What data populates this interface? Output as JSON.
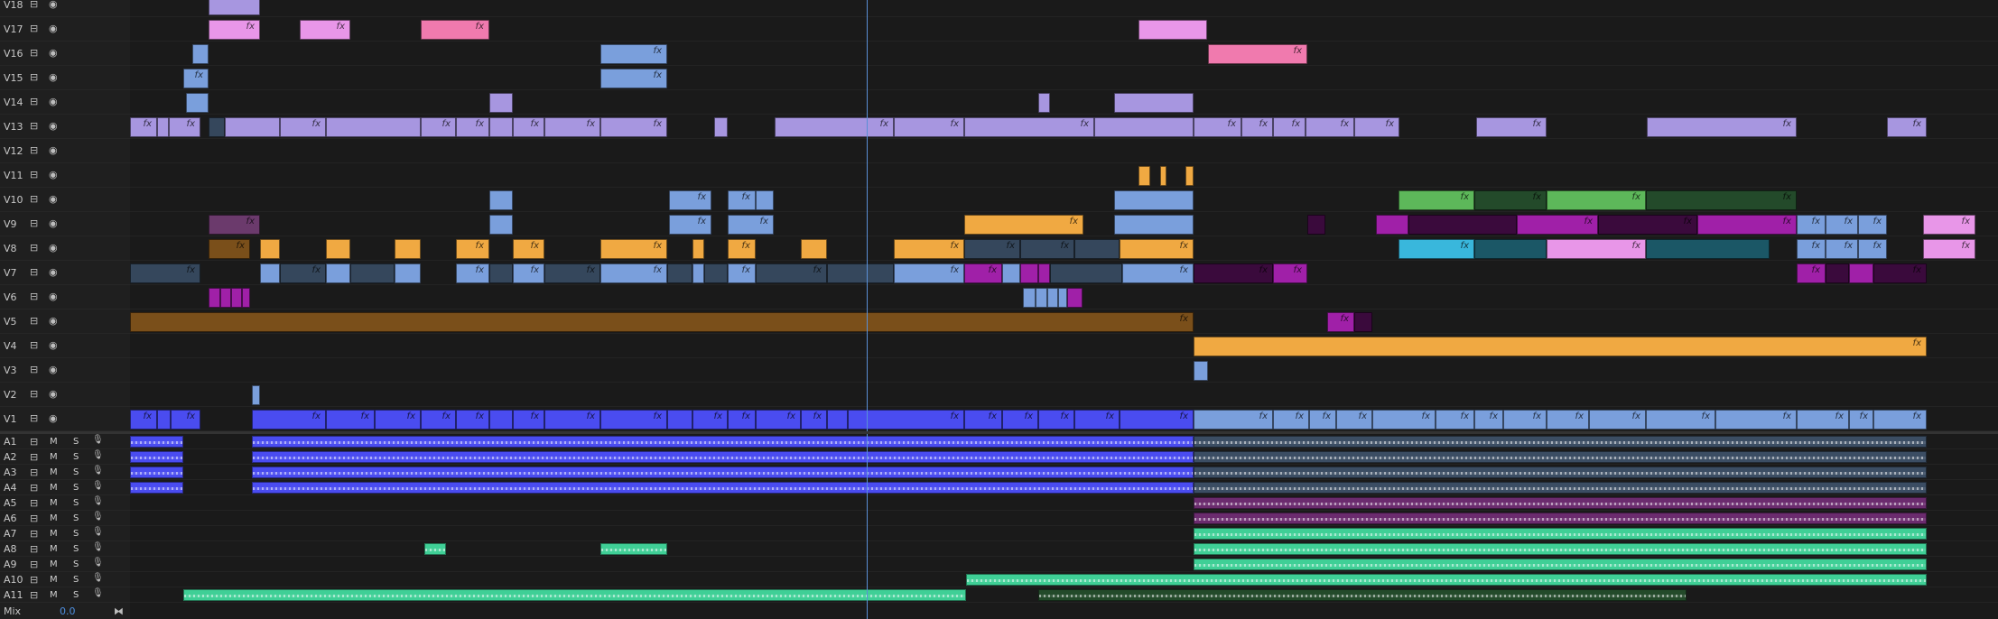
{
  "colors": {
    "lavender": "#a796e0",
    "blue": "#7a9fdc",
    "royal": "#4a4cf0",
    "orange": "#f0a942",
    "brown": "#7a4f1a",
    "pink": "#f07aae",
    "lightpink": "#e896e8",
    "magenta": "#a020a8",
    "darkmagenta": "#3a0a3c",
    "green": "#5db85a",
    "darkgreen": "#234a2a",
    "cyan": "#39b7dc",
    "teal": "#1b5766",
    "slate": "#35475c",
    "plum": "#6b3a6c",
    "mint": "#3fcf96",
    "audioslate": "#3b4d63",
    "audiopurple": "#6b2b6e",
    "audioroyal": "#4a4cf0"
  },
  "fx_label": "fx",
  "video_tracks": [
    {
      "label": "V18",
      "clips": [
        [
          231,
          288,
          "lavender",
          0
        ]
      ]
    },
    {
      "label": "V17",
      "clips": [
        [
          231,
          288,
          "lightpink",
          1
        ],
        [
          332,
          388,
          "lightpink",
          1
        ],
        [
          466,
          542,
          "pink",
          1
        ],
        [
          1261,
          1337,
          "lightpink",
          0
        ]
      ]
    },
    {
      "label": "V16",
      "clips": [
        [
          213,
          231,
          "blue",
          0
        ],
        [
          665,
          739,
          "blue",
          1
        ],
        [
          1338,
          1448,
          "pink",
          1
        ]
      ]
    },
    {
      "label": "V15",
      "clips": [
        [
          203,
          231,
          "blue",
          1
        ],
        [
          665,
          739,
          "blue",
          1
        ]
      ]
    },
    {
      "label": "V14",
      "clips": [
        [
          206,
          231,
          "blue",
          0
        ],
        [
          542,
          568,
          "lavender",
          0
        ],
        [
          1150,
          1163,
          "lavender",
          0
        ],
        [
          1234,
          1322,
          "lavender",
          0
        ]
      ]
    },
    {
      "label": "V13",
      "clips": [
        [
          144,
          174,
          "lavender",
          1
        ],
        [
          174,
          187,
          "lavender",
          0
        ],
        [
          187,
          222,
          "lavender",
          1
        ],
        [
          231,
          249,
          "slate",
          0
        ],
        [
          249,
          310,
          "lavender",
          0
        ],
        [
          310,
          361,
          "lavender",
          1
        ],
        [
          361,
          466,
          "lavender",
          0
        ],
        [
          466,
          505,
          "lavender",
          1
        ],
        [
          505,
          542,
          "lavender",
          1
        ],
        [
          542,
          568,
          "lavender",
          0
        ],
        [
          568,
          603,
          "lavender",
          1
        ],
        [
          603,
          665,
          "lavender",
          1
        ],
        [
          665,
          739,
          "lavender",
          1
        ],
        [
          791,
          806,
          "lavender",
          0
        ],
        [
          858,
          990,
          "lavender",
          1
        ],
        [
          990,
          1068,
          "lavender",
          1
        ],
        [
          1068,
          1212,
          "lavender",
          1
        ],
        [
          1212,
          1322,
          "lavender",
          0
        ],
        [
          1322,
          1375,
          "lavender",
          1
        ],
        [
          1375,
          1410,
          "lavender",
          1
        ],
        [
          1410,
          1446,
          "lavender",
          1
        ],
        [
          1446,
          1500,
          "lavender",
          1
        ],
        [
          1500,
          1550,
          "lavender",
          1
        ],
        [
          1635,
          1713,
          "lavender",
          1
        ],
        [
          1824,
          1990,
          "lavender",
          1
        ],
        [
          2090,
          2134,
          "lavender",
          1
        ]
      ]
    },
    {
      "label": "V12",
      "clips": []
    },
    {
      "label": "V11",
      "clips": [
        [
          1261,
          1274,
          "orange",
          0
        ],
        [
          1285,
          1292,
          "orange",
          0
        ],
        [
          1313,
          1322,
          "orange",
          0
        ]
      ]
    },
    {
      "label": "V10",
      "clips": [
        [
          542,
          568,
          "blue",
          0
        ],
        [
          741,
          788,
          "blue",
          1
        ],
        [
          806,
          837,
          "blue",
          1
        ],
        [
          837,
          857,
          "blue",
          0
        ],
        [
          1234,
          1322,
          "blue",
          0
        ],
        [
          1549,
          1633,
          "green",
          1
        ],
        [
          1633,
          1713,
          "darkgreen",
          1
        ],
        [
          1713,
          1823,
          "green",
          1
        ],
        [
          1823,
          1990,
          "darkgreen",
          1
        ]
      ]
    },
    {
      "label": "V9",
      "clips": [
        [
          231,
          288,
          "plum",
          1
        ],
        [
          542,
          568,
          "blue",
          0
        ],
        [
          741,
          788,
          "blue",
          1
        ],
        [
          806,
          857,
          "blue",
          1
        ],
        [
          1068,
          1200,
          "orange",
          1
        ],
        [
          1234,
          1322,
          "blue",
          0
        ],
        [
          1448,
          1468,
          "darkmagenta",
          0
        ],
        [
          1524,
          1560,
          "magenta",
          0
        ],
        [
          1560,
          1680,
          "darkmagenta",
          0
        ],
        [
          1680,
          1770,
          "magenta",
          1
        ],
        [
          1770,
          1880,
          "darkmagenta",
          1
        ],
        [
          1880,
          1990,
          "magenta",
          1
        ],
        [
          1990,
          2022,
          "blue",
          1
        ],
        [
          2022,
          2058,
          "blue",
          1
        ],
        [
          2058,
          2090,
          "blue",
          1
        ],
        [
          2130,
          2188,
          "lightpink",
          1
        ]
      ]
    },
    {
      "label": "V8",
      "clips": [
        [
          231,
          277,
          "brown",
          1
        ],
        [
          288,
          310,
          "orange",
          0
        ],
        [
          361,
          388,
          "orange",
          0
        ],
        [
          437,
          466,
          "orange",
          0
        ],
        [
          505,
          542,
          "orange",
          1
        ],
        [
          568,
          603,
          "orange",
          1
        ],
        [
          665,
          739,
          "orange",
          1
        ],
        [
          767,
          780,
          "orange",
          0
        ],
        [
          806,
          837,
          "orange",
          1
        ],
        [
          887,
          916,
          "orange",
          0
        ],
        [
          990,
          1068,
          "orange",
          1
        ],
        [
          1068,
          1130,
          "slate",
          1
        ],
        [
          1130,
          1190,
          "slate",
          1
        ],
        [
          1190,
          1240,
          "slate",
          0
        ],
        [
          1240,
          1322,
          "orange",
          1
        ],
        [
          1549,
          1633,
          "cyan",
          1
        ],
        [
          1633,
          1713,
          "teal",
          0
        ],
        [
          1713,
          1823,
          "lightpink",
          1
        ],
        [
          1823,
          1960,
          "teal",
          0
        ],
        [
          1990,
          2022,
          "blue",
          1
        ],
        [
          2022,
          2058,
          "blue",
          1
        ],
        [
          2058,
          2090,
          "blue",
          1
        ],
        [
          2130,
          2188,
          "lightpink",
          1
        ]
      ]
    },
    {
      "label": "V7",
      "clips": [
        [
          144,
          222,
          "slate",
          1
        ],
        [
          288,
          310,
          "blue",
          0
        ],
        [
          310,
          361,
          "slate",
          1
        ],
        [
          361,
          388,
          "blue",
          0
        ],
        [
          388,
          437,
          "slate",
          0
        ],
        [
          437,
          466,
          "blue",
          0
        ],
        [
          505,
          542,
          "blue",
          1
        ],
        [
          542,
          568,
          "slate",
          0
        ],
        [
          568,
          603,
          "blue",
          1
        ],
        [
          603,
          665,
          "slate",
          1
        ],
        [
          665,
          739,
          "blue",
          1
        ],
        [
          739,
          767,
          "slate",
          0
        ],
        [
          767,
          780,
          "blue",
          0
        ],
        [
          780,
          806,
          "slate",
          0
        ],
        [
          806,
          837,
          "blue",
          1
        ],
        [
          837,
          916,
          "slate",
          1
        ],
        [
          916,
          990,
          "slate",
          0
        ],
        [
          990,
          1068,
          "blue",
          1
        ],
        [
          1068,
          1110,
          "magenta",
          1
        ],
        [
          1110,
          1130,
          "blue",
          0
        ],
        [
          1130,
          1150,
          "magenta",
          0
        ],
        [
          1150,
          1163,
          "magenta",
          0
        ],
        [
          1163,
          1243,
          "slate",
          0
        ],
        [
          1243,
          1322,
          "blue",
          1
        ],
        [
          1322,
          1410,
          "darkmagenta",
          1
        ],
        [
          1410,
          1448,
          "magenta",
          1
        ],
        [
          1990,
          2022,
          "magenta",
          1
        ],
        [
          2022,
          2048,
          "darkmagenta",
          0
        ],
        [
          2048,
          2075,
          "magenta",
          0
        ],
        [
          2075,
          2134,
          "darkmagenta",
          1
        ]
      ]
    },
    {
      "label": "V6",
      "clips": [
        [
          231,
          244,
          "magenta",
          0
        ],
        [
          244,
          256,
          "magenta",
          0
        ],
        [
          256,
          268,
          "magenta",
          0
        ],
        [
          268,
          277,
          "magenta",
          0
        ],
        [
          1133,
          1147,
          "blue",
          0
        ],
        [
          1147,
          1160,
          "blue",
          0
        ],
        [
          1160,
          1172,
          "blue",
          0
        ],
        [
          1172,
          1182,
          "blue",
          0
        ],
        [
          1182,
          1199,
          "magenta",
          0
        ]
      ]
    },
    {
      "label": "V5",
      "clips": [
        [
          144,
          1322,
          "brown",
          1
        ],
        [
          1470,
          1500,
          "magenta",
          1
        ],
        [
          1500,
          1520,
          "darkmagenta",
          0
        ]
      ]
    },
    {
      "label": "V4",
      "clips": [
        [
          1322,
          2134,
          "orange",
          1
        ]
      ]
    },
    {
      "label": "V3",
      "clips": [
        [
          1322,
          1338,
          "blue",
          0
        ]
      ]
    },
    {
      "label": "V2",
      "clips": [
        [
          279,
          288,
          "blue",
          0
        ]
      ]
    },
    {
      "label": "V1",
      "clips": [
        [
          144,
          174,
          "royal",
          1
        ],
        [
          174,
          189,
          "royal",
          0
        ],
        [
          189,
          222,
          "royal",
          1
        ],
        [
          279,
          361,
          "royal",
          1
        ],
        [
          361,
          415,
          "royal",
          1
        ],
        [
          415,
          466,
          "royal",
          1
        ],
        [
          466,
          505,
          "royal",
          1
        ],
        [
          505,
          542,
          "royal",
          1
        ],
        [
          542,
          568,
          "royal",
          0
        ],
        [
          568,
          603,
          "royal",
          1
        ],
        [
          603,
          665,
          "royal",
          1
        ],
        [
          665,
          739,
          "royal",
          1
        ],
        [
          739,
          767,
          "royal",
          0
        ],
        [
          767,
          806,
          "royal",
          1
        ],
        [
          806,
          837,
          "royal",
          1
        ],
        [
          837,
          887,
          "royal",
          1
        ],
        [
          887,
          916,
          "royal",
          1
        ],
        [
          916,
          939,
          "royal",
          0
        ],
        [
          939,
          1068,
          "royal",
          1
        ],
        [
          1068,
          1110,
          "royal",
          1
        ],
        [
          1110,
          1150,
          "royal",
          1
        ],
        [
          1150,
          1190,
          "royal",
          1
        ],
        [
          1190,
          1240,
          "royal",
          1
        ],
        [
          1240,
          1322,
          "royal",
          1
        ],
        [
          1322,
          1410,
          "blue",
          1
        ],
        [
          1410,
          1450,
          "blue",
          1
        ],
        [
          1450,
          1480,
          "blue",
          1
        ],
        [
          1480,
          1520,
          "blue",
          1
        ],
        [
          1520,
          1590,
          "blue",
          1
        ],
        [
          1590,
          1633,
          "blue",
          1
        ],
        [
          1633,
          1665,
          "blue",
          1
        ],
        [
          1665,
          1713,
          "blue",
          1
        ],
        [
          1713,
          1760,
          "blue",
          1
        ],
        [
          1760,
          1823,
          "blue",
          1
        ],
        [
          1823,
          1900,
          "blue",
          1
        ],
        [
          1900,
          1990,
          "blue",
          1
        ],
        [
          1990,
          2048,
          "blue",
          1
        ],
        [
          2048,
          2075,
          "blue",
          1
        ],
        [
          2075,
          2134,
          "blue",
          1
        ]
      ]
    }
  ],
  "audio_tracks": [
    {
      "label": "A1",
      "m": "M",
      "s": "S",
      "clips": [
        [
          144,
          203,
          "audioroyal"
        ],
        [
          279,
          1322,
          "audioroyal"
        ],
        [
          1322,
          2134,
          "audioslate"
        ]
      ]
    },
    {
      "label": "A2",
      "m": "M",
      "s": "S",
      "clips": [
        [
          144,
          203,
          "audioroyal"
        ],
        [
          279,
          1322,
          "audioroyal"
        ],
        [
          1322,
          2134,
          "audioslate"
        ]
      ]
    },
    {
      "label": "A3",
      "m": "M",
      "s": "S",
      "clips": [
        [
          144,
          203,
          "audioroyal"
        ],
        [
          279,
          1322,
          "audioroyal"
        ],
        [
          1322,
          2134,
          "audioslate"
        ]
      ]
    },
    {
      "label": "A4",
      "m": "M",
      "s": "S",
      "clips": [
        [
          144,
          203,
          "audioroyal"
        ],
        [
          279,
          1322,
          "audioroyal"
        ],
        [
          1322,
          2134,
          "audioslate"
        ]
      ]
    },
    {
      "label": "A5",
      "m": "M",
      "s": "S",
      "clips": [
        [
          1322,
          2134,
          "audiopurple"
        ]
      ]
    },
    {
      "label": "A6",
      "m": "M",
      "s": "S",
      "clips": [
        [
          1322,
          2134,
          "audiopurple"
        ]
      ]
    },
    {
      "label": "A7",
      "m": "M",
      "s": "S",
      "clips": [
        [
          1322,
          2134,
          "mint"
        ]
      ]
    },
    {
      "label": "A8",
      "m": "M",
      "s": "S",
      "clips": [
        [
          470,
          494,
          "mint"
        ],
        [
          665,
          739,
          "mint"
        ],
        [
          1322,
          2134,
          "mint"
        ]
      ]
    },
    {
      "label": "A9",
      "m": "M",
      "s": "S",
      "clips": [
        [
          1322,
          2134,
          "mint"
        ]
      ]
    },
    {
      "label": "A10",
      "m": "M",
      "s": "S",
      "clips": [
        [
          1070,
          2134,
          "mint"
        ]
      ]
    },
    {
      "label": "A11",
      "m": "M",
      "s": "S",
      "clips": [
        [
          203,
          1070,
          "mint"
        ],
        [
          1150,
          1868,
          "darkgreen"
        ]
      ]
    }
  ],
  "mix": {
    "label": "Mix",
    "value": "0.0"
  }
}
